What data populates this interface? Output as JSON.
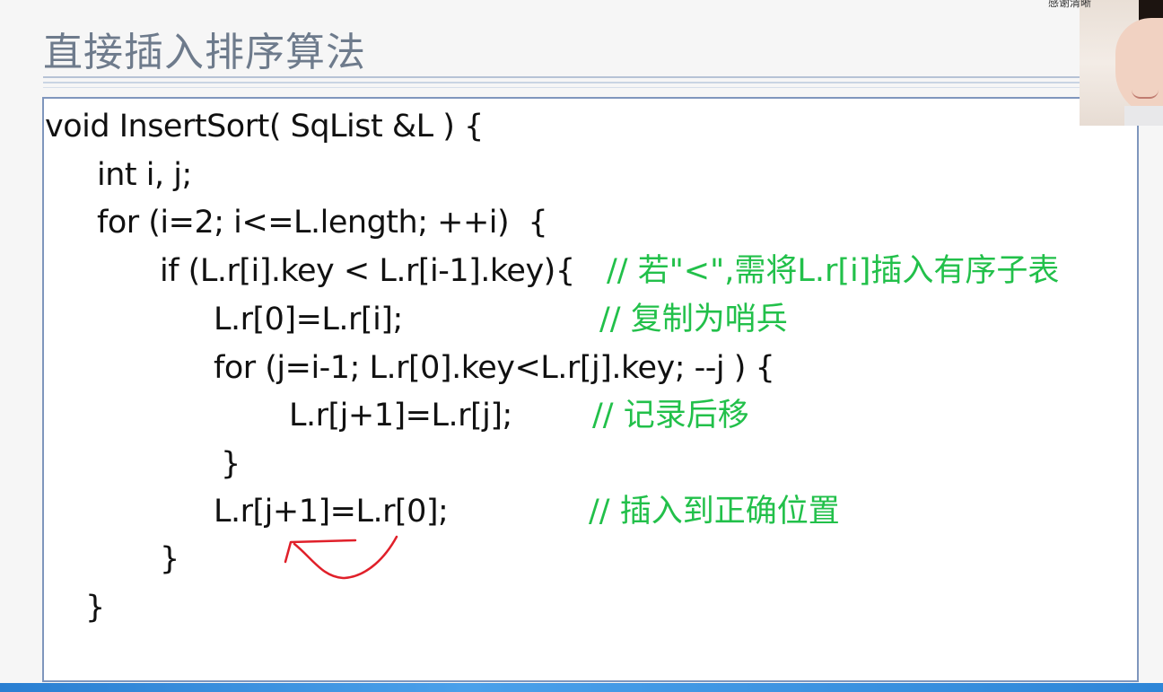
{
  "slide": {
    "title": "直接插入排序算法"
  },
  "webcam": {
    "caption": "感谢清晰"
  },
  "code": {
    "line1": "void InsertSort( SqList &L ) {",
    "line2": "int i, j;",
    "line3": "for (i=2; i<=L.length; ++i)  {",
    "line4": "if (L.r[i].key < L.r[i-1].key){",
    "line4_comment": "// 若\"<\",需将L.r[i]插入有序子表",
    "line5": "L.r[0]=L.r[i];",
    "line5_comment": "// 复制为哨兵",
    "line6": "for (j=i-1; L.r[0].key<L.r[j].key; --j ) {",
    "line7": "L.r[j+1]=L.r[j];",
    "line7_comment": "// 记录后移",
    "line8": "}",
    "line9": "L.r[j+1]=L.r[0];",
    "line9_comment": "// 插入到正确位置",
    "line10": "}",
    "line11": "}"
  },
  "colors": {
    "code_text": "#111111",
    "comment": "#22c04a",
    "title": "#6e7b8c",
    "box_border": "#7f96bd",
    "annotation": "#e0202a"
  }
}
